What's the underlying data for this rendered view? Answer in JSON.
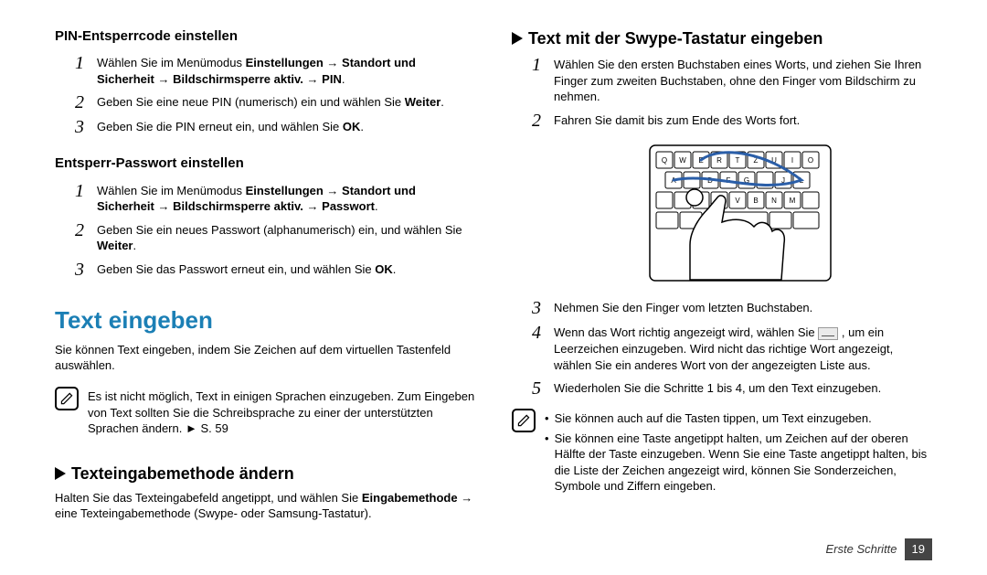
{
  "left": {
    "pin_title": "PIN-Entsperrcode einstellen",
    "pin_steps": [
      {
        "n": "1",
        "html": "Wählen Sie im Menümodus <b>Einstellungen</b> → <b>Standort und Sicherheit</b> → <b>Bildschirmsperre aktiv.</b> → <b>PIN</b>."
      },
      {
        "n": "2",
        "html": "Geben Sie eine neue PIN (numerisch) ein und wählen Sie <b>Weiter</b>."
      },
      {
        "n": "3",
        "html": "Geben Sie die PIN erneut ein, und wählen Sie <b>OK</b>."
      }
    ],
    "pw_title": "Entsperr-Passwort einstellen",
    "pw_steps": [
      {
        "n": "1",
        "html": "Wählen Sie im Menümodus <b>Einstellungen</b> → <b>Standort und Sicherheit</b> → <b>Bildschirmsperre aktiv.</b> → <b>Passwort</b>."
      },
      {
        "n": "2",
        "html": "Geben Sie ein neues Passwort (alphanumerisch) ein, und wählen Sie <b>Weiter</b>."
      },
      {
        "n": "3",
        "html": "Geben Sie das Passwort erneut ein, und wählen Sie <b>OK</b>."
      }
    ],
    "text_title": "Text eingeben",
    "text_intro": "Sie können Text eingeben, indem Sie Zeichen auf dem virtuellen Tastenfeld auswählen.",
    "text_note": "Es ist nicht möglich, Text in einigen Sprachen einzugeben. Zum Eingeben von Text sollten Sie die Schreibsprache zu einer der unterstützten Sprachen ändern. ► S. 59",
    "method_title": "Texteingabemethode ändern",
    "method_body": "Halten Sie das Texteingabefeld angetippt, und wählen Sie <b>Eingabemethode</b> → eine Texteingabemethode (Swype- oder Samsung-Tastatur)."
  },
  "right": {
    "swype_title": "Text mit der Swype-Tastatur eingeben",
    "swype_steps_a": [
      {
        "n": "1",
        "html": "Wählen Sie den ersten Buchstaben eines Worts, und ziehen Sie Ihren Finger zum zweiten Buchstaben, ohne den Finger vom Bildschirm zu nehmen."
      },
      {
        "n": "2",
        "html": "Fahren Sie damit bis zum Ende des Worts fort."
      }
    ],
    "swype_steps_b": [
      {
        "n": "3",
        "html": "Nehmen Sie den Finger vom letzten Buchstaben."
      },
      {
        "n": "4",
        "html": "Wenn das Wort richtig angezeigt wird, wählen Sie <span class=\"inline-icon\" data-name=\"space-key-icon\" data-interactable=\"false\"></span> , um ein Leerzeichen einzugeben. Wird nicht das richtige Wort angezeigt, wählen Sie ein anderes Wort von der angezeigten Liste aus."
      },
      {
        "n": "5",
        "html": "Wiederholen Sie die Schritte 1 bis 4, um den Text einzugeben."
      }
    ],
    "swype_notes": [
      "Sie können auch auf die Tasten tippen, um Text einzugeben.",
      "Sie können eine Taste angetippt halten, um Zeichen auf der oberen Hälfte der Taste einzugeben. Wenn Sie eine Taste angetippt halten, bis die Liste der Zeichen angezeigt wird, können Sie Sonderzeichen, Symbole und Ziffern eingeben."
    ]
  },
  "footer": {
    "section": "Erste Schritte",
    "page": "19"
  }
}
